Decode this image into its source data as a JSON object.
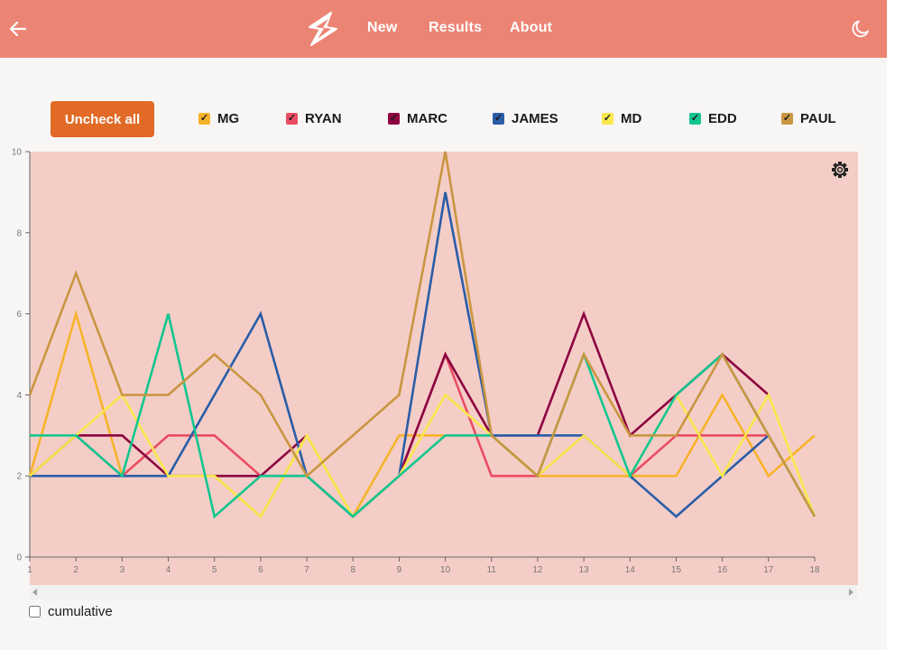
{
  "nav": {
    "links": [
      "New",
      "Results",
      "About"
    ]
  },
  "controls": {
    "uncheck_all_label": "Uncheck all",
    "cumulative_label": "cumulative",
    "cumulative_checked": false
  },
  "colors": {
    "navbar": "#ec8474",
    "button": "#e06a26",
    "plot_background": "#f5cdc7"
  },
  "chart_data": {
    "type": "line",
    "x": [
      1,
      2,
      3,
      4,
      5,
      6,
      7,
      8,
      9,
      10,
      11,
      12,
      13,
      14,
      15,
      16,
      17,
      18
    ],
    "ylim": [
      0,
      10
    ],
    "y_ticks": [
      0,
      2,
      4,
      6,
      8,
      10
    ],
    "xlabel": "",
    "ylabel": "",
    "legend_position": "top",
    "series": [
      {
        "name": "MG",
        "color": "#f7b32b",
        "checked": true,
        "values": [
          2,
          6,
          2,
          2,
          2,
          1,
          3,
          1,
          3,
          3,
          3,
          2,
          2,
          2,
          2,
          4,
          2,
          3
        ]
      },
      {
        "name": "RYAN",
        "color": "#ea4c63",
        "checked": true,
        "values": [
          2,
          3,
          2,
          3,
          3,
          2,
          2,
          1,
          2,
          5,
          2,
          2,
          3,
          2,
          3,
          3,
          3,
          null
        ]
      },
      {
        "name": "MARC",
        "color": "#8c0440",
        "checked": true,
        "values": [
          2,
          3,
          3,
          2,
          2,
          2,
          3,
          null,
          2,
          5,
          3,
          3,
          6,
          3,
          4,
          5,
          4,
          null
        ]
      },
      {
        "name": "JAMES",
        "color": "#2a5da8",
        "checked": true,
        "values": [
          2,
          2,
          2,
          2,
          4,
          6,
          2,
          1,
          2,
          9,
          3,
          3,
          3,
          2,
          1,
          2,
          3,
          null
        ]
      },
      {
        "name": "MD",
        "color": "#f9e84e",
        "checked": true,
        "values": [
          2,
          3,
          4,
          2,
          2,
          1,
          3,
          1,
          2,
          4,
          3,
          2,
          3,
          2,
          4,
          2,
          4,
          1
        ]
      },
      {
        "name": "EDD",
        "color": "#13c690",
        "checked": true,
        "values": [
          3,
          3,
          2,
          6,
          1,
          2,
          2,
          1,
          2,
          3,
          3,
          2,
          5,
          2,
          4,
          5,
          3,
          1
        ]
      },
      {
        "name": "PAUL",
        "color": "#c99641",
        "checked": true,
        "values": [
          4,
          7,
          4,
          4,
          5,
          4,
          2,
          3,
          4,
          10,
          3,
          2,
          5,
          3,
          3,
          5,
          3,
          1
        ]
      }
    ]
  }
}
